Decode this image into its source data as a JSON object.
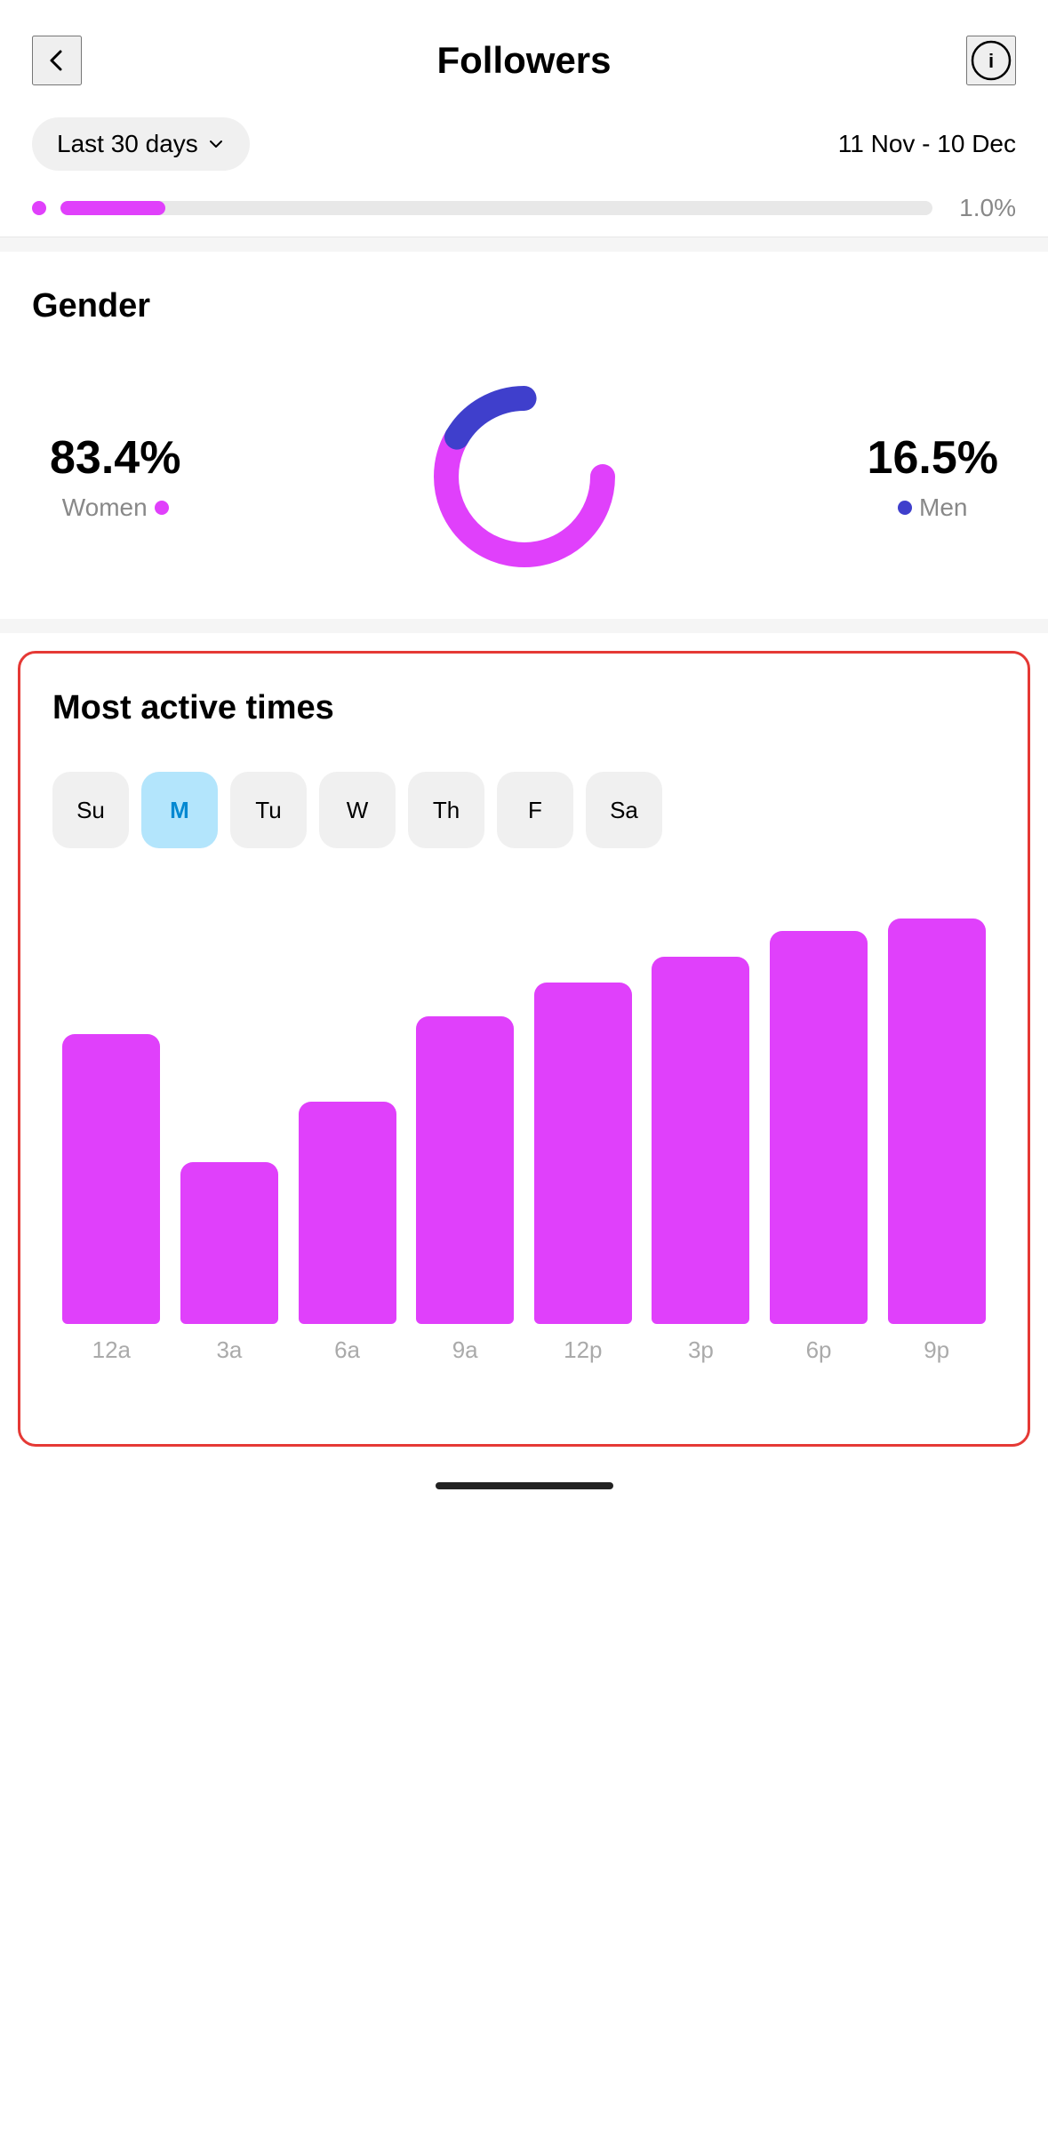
{
  "header": {
    "title": "Followers",
    "back_label": "back",
    "info_label": "info"
  },
  "date_filter": {
    "dropdown_label": "Last 30 days",
    "date_range": "11 Nov - 10 Dec"
  },
  "partial_row": {
    "percent": "1.0%",
    "bar_fill_width": "12%"
  },
  "gender": {
    "section_title": "Gender",
    "women_percent": "83.4%",
    "women_label": "Women",
    "men_percent": "16.5%",
    "men_label": "Men",
    "women_value": 83.4,
    "men_value": 16.5
  },
  "most_active_times": {
    "section_title": "Most active times",
    "days": [
      {
        "label": "Su",
        "active": false
      },
      {
        "label": "M",
        "active": true
      },
      {
        "label": "Tu",
        "active": false
      },
      {
        "label": "W",
        "active": false
      },
      {
        "label": "Th",
        "active": false
      },
      {
        "label": "F",
        "active": false
      },
      {
        "label": "Sa",
        "active": false
      }
    ],
    "bars": [
      {
        "label": "12a",
        "height_pct": 68
      },
      {
        "label": "3a",
        "height_pct": 38
      },
      {
        "label": "6a",
        "height_pct": 52
      },
      {
        "label": "9a",
        "height_pct": 72
      },
      {
        "label": "12p",
        "height_pct": 80
      },
      {
        "label": "3p",
        "height_pct": 86
      },
      {
        "label": "6p",
        "height_pct": 92
      },
      {
        "label": "9p",
        "height_pct": 95
      }
    ]
  },
  "colors": {
    "pink": "#e040fb",
    "blue_purple": "#3f3fcc",
    "light_blue": "#b3e5fc",
    "red_border": "#e53935",
    "bar_magenta": "#e040fb"
  }
}
